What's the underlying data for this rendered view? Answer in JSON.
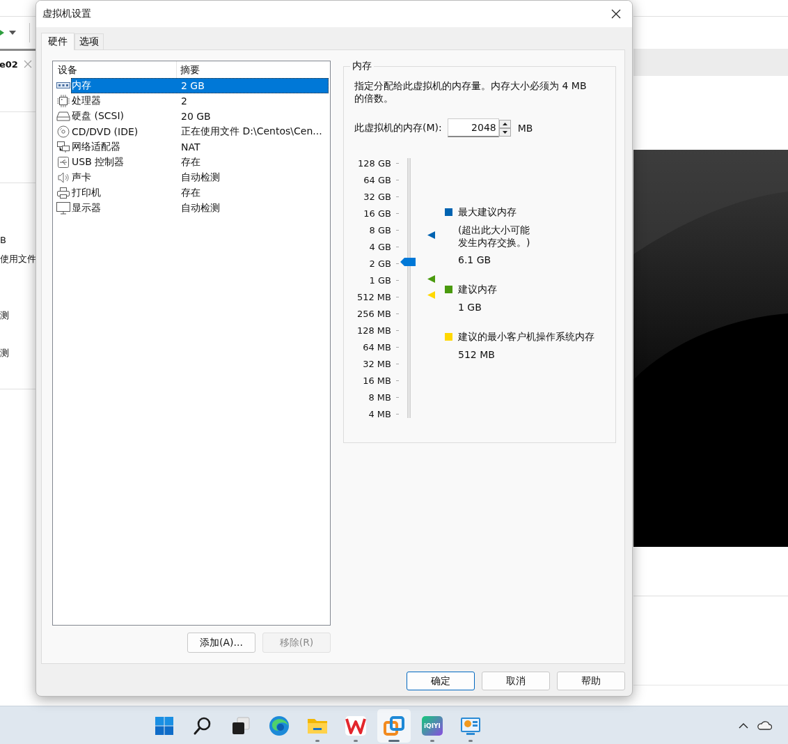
{
  "background_window": {
    "tab": {
      "label": "e02"
    },
    "texts": [
      "B",
      "使用文件",
      "测",
      "测"
    ]
  },
  "dialog": {
    "title": "虚拟机设置",
    "tabs": [
      {
        "label": "硬件",
        "selected": true
      },
      {
        "label": "选项",
        "selected": false
      }
    ],
    "device_list": {
      "columns": [
        "设备",
        "摘要"
      ],
      "rows": [
        {
          "kind": "memory",
          "device": "内存",
          "summary": "2 GB",
          "selected": true
        },
        {
          "kind": "cpu",
          "device": "处理器",
          "summary": "2",
          "selected": false
        },
        {
          "kind": "disk",
          "device": "硬盘 (SCSI)",
          "summary": "20 GB",
          "selected": false
        },
        {
          "kind": "cdrom",
          "device": "CD/DVD (IDE)",
          "summary": "正在使用文件 D:\\Centos\\Cen...",
          "selected": false
        },
        {
          "kind": "network",
          "device": "网络适配器",
          "summary": "NAT",
          "selected": false
        },
        {
          "kind": "usb",
          "device": "USB 控制器",
          "summary": "存在",
          "selected": false
        },
        {
          "kind": "sound",
          "device": "声卡",
          "summary": "自动检测",
          "selected": false
        },
        {
          "kind": "printer",
          "device": "打印机",
          "summary": "存在",
          "selected": false
        },
        {
          "kind": "display",
          "device": "显示器",
          "summary": "自动检测",
          "selected": false
        }
      ]
    },
    "list_buttons": [
      {
        "label": "添加(A)...",
        "disabled": false
      },
      {
        "label": "移除(R)",
        "disabled": true
      }
    ],
    "memory": {
      "group_title": "内存",
      "description": "指定分配给此虚拟机的内存量。内存大小必须为 4 MB 的倍数。",
      "field": {
        "label": "此虚拟机的内存(M):",
        "value": "2048",
        "unit": "MB"
      },
      "slider": {
        "ticks": [
          "128 GB",
          "64 GB",
          "32 GB",
          "16 GB",
          "8 GB",
          "4 GB",
          "2 GB",
          "1 GB",
          "512 MB",
          "256 MB",
          "128 MB",
          "64 MB",
          "32 MB",
          "16 MB",
          "8 MB",
          "4 MB"
        ],
        "level": 0.6,
        "markers": [
          {
            "color": "#0063b1",
            "level": 0.707
          },
          {
            "color": "#4a9a0e",
            "level": 0.533
          },
          {
            "color": "#ffd800",
            "level": 0.467
          }
        ]
      },
      "legend": [
        {
          "color": "#0063b1",
          "title": "最大建议内存",
          "note_lines": [
            "(超出此大小可能",
            "发生内存交换。)"
          ],
          "value": "6.1 GB"
        },
        {
          "color": "#4a9a0e",
          "title": "建议内存",
          "value": "1 GB"
        },
        {
          "color": "#ffd800",
          "title": "建议的最小客户机操作系统内存",
          "value": "512 MB"
        }
      ]
    },
    "footer_buttons": [
      {
        "label": "确定",
        "default": true
      },
      {
        "label": "取消",
        "default": false
      },
      {
        "label": "帮助",
        "default": false
      }
    ]
  },
  "taskbar": {
    "apps": [
      {
        "kind": "start",
        "running": false,
        "selected": false
      },
      {
        "kind": "search",
        "running": false,
        "selected": false
      },
      {
        "kind": "taskview",
        "running": false,
        "selected": false
      },
      {
        "kind": "browser",
        "running": false,
        "selected": false
      },
      {
        "kind": "folder",
        "running": true,
        "selected": false
      },
      {
        "kind": "office",
        "running": true,
        "selected": false
      },
      {
        "kind": "vm",
        "running": true,
        "selected": true
      },
      {
        "kind": "video",
        "running": true,
        "selected": false,
        "label": "iQIYI"
      },
      {
        "kind": "monitor",
        "running": true,
        "selected": false
      }
    ],
    "tray": [
      {
        "kind": "chevron"
      },
      {
        "kind": "cloud"
      }
    ]
  }
}
